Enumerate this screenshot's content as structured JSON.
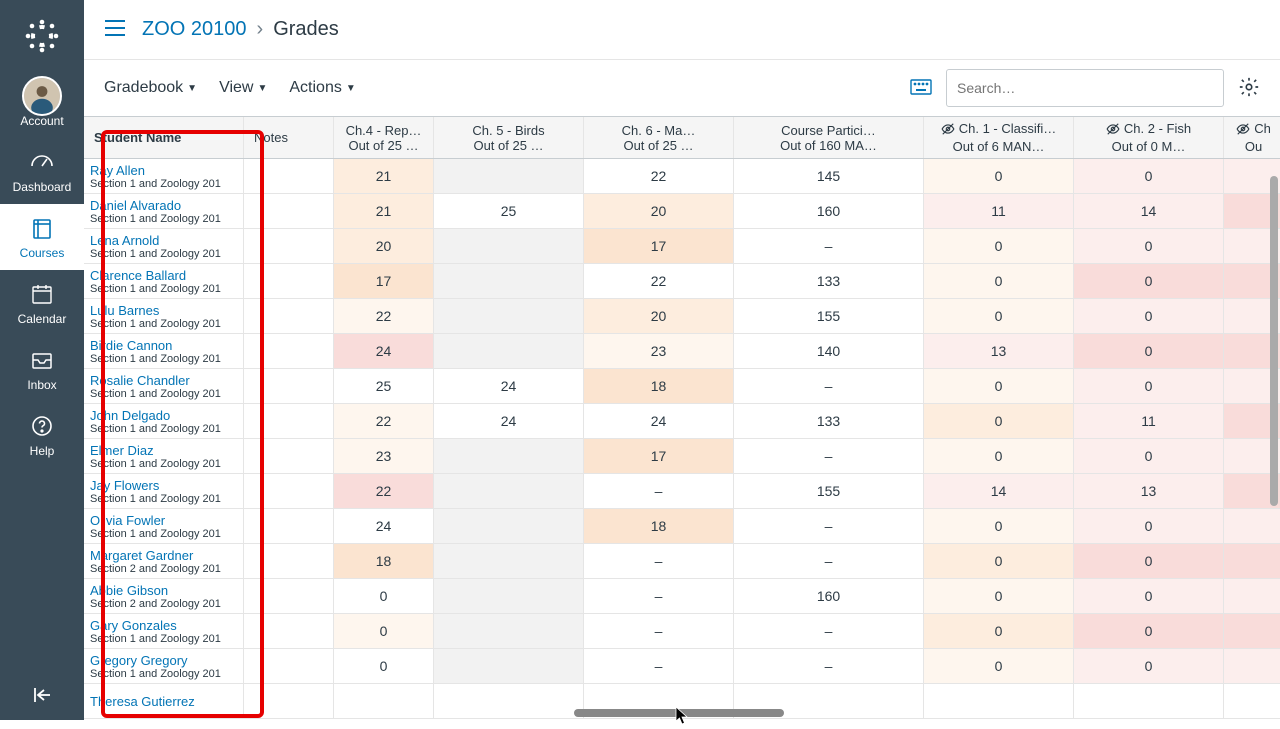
{
  "nav": {
    "account": "Account",
    "dashboard": "Dashboard",
    "courses": "Courses",
    "calendar": "Calendar",
    "inbox": "Inbox",
    "help": "Help"
  },
  "breadcrumb": {
    "course": "ZOO 20100",
    "page": "Grades"
  },
  "toolbar": {
    "gradebook": "Gradebook",
    "view": "View",
    "actions": "Actions",
    "search_placeholder": "Search…"
  },
  "columns": {
    "student": "Student Name",
    "notes": "Notes",
    "assignments": [
      {
        "title": "Ch.4 - Rep…",
        "sub": "Out of 25 …",
        "hidden": false
      },
      {
        "title": "Ch. 5 - Birds",
        "sub": "Out of 25 …",
        "hidden": false
      },
      {
        "title": "Ch. 6 - Ma…",
        "sub": "Out of 25 …",
        "hidden": false
      },
      {
        "title": "Course Partici…",
        "sub": "Out of 160 MA…",
        "hidden": false
      },
      {
        "title": "Ch. 1 - Classifi…",
        "sub": "Out of 6 MAN…",
        "hidden": true
      },
      {
        "title": "Ch. 2 - Fish",
        "sub": "Out of 0 M…",
        "hidden": true
      },
      {
        "title": "Ch",
        "sub": "Ou",
        "hidden": true
      }
    ]
  },
  "students": [
    {
      "name": "Ray Allen",
      "section": "Section 1 and Zoology 201",
      "cells": [
        "21",
        "",
        "22",
        "145",
        "0",
        "0",
        ""
      ]
    },
    {
      "name": "Daniel Alvarado",
      "section": "Section 1 and Zoology 201",
      "cells": [
        "21",
        "25",
        "20",
        "160",
        "11",
        "14",
        ""
      ]
    },
    {
      "name": "Lena Arnold",
      "section": "Section 1 and Zoology 201",
      "cells": [
        "20",
        "",
        "17",
        "–",
        "0",
        "0",
        ""
      ]
    },
    {
      "name": "Clarence Ballard",
      "section": "Section 1 and Zoology 201",
      "cells": [
        "17",
        "",
        "22",
        "133",
        "0",
        "0",
        ""
      ]
    },
    {
      "name": "Lulu Barnes",
      "section": "Section 1 and Zoology 201",
      "cells": [
        "22",
        "",
        "20",
        "155",
        "0",
        "0",
        ""
      ]
    },
    {
      "name": "Birdie Cannon",
      "section": "Section 1 and Zoology 201",
      "cells": [
        "24",
        "",
        "23",
        "140",
        "13",
        "0",
        ""
      ]
    },
    {
      "name": "Rosalie Chandler",
      "section": "Section 1 and Zoology 201",
      "cells": [
        "25",
        "24",
        "18",
        "–",
        "0",
        "0",
        ""
      ]
    },
    {
      "name": "John Delgado",
      "section": "Section 1 and Zoology 201",
      "cells": [
        "22",
        "24",
        "24",
        "133",
        "0",
        "11",
        ""
      ]
    },
    {
      "name": "Elmer Diaz",
      "section": "Section 1 and Zoology 201",
      "cells": [
        "23",
        "",
        "17",
        "–",
        "0",
        "0",
        ""
      ]
    },
    {
      "name": "Jay Flowers",
      "section": "Section 1 and Zoology 201",
      "cells": [
        "22",
        "",
        "–",
        "155",
        "14",
        "13",
        ""
      ]
    },
    {
      "name": "Olivia Fowler",
      "section": "Section 1 and Zoology 201",
      "cells": [
        "24",
        "",
        "18",
        "–",
        "0",
        "0",
        ""
      ]
    },
    {
      "name": "Margaret Gardner",
      "section": "Section 2 and Zoology 201",
      "cells": [
        "18",
        "",
        "–",
        "–",
        "0",
        "0",
        ""
      ]
    },
    {
      "name": "Abbie Gibson",
      "section": "Section 2 and Zoology 201",
      "cells": [
        "0",
        "",
        "–",
        "160",
        "0",
        "0",
        ""
      ]
    },
    {
      "name": "Gary Gonzales",
      "section": "Section 1 and Zoology 201",
      "cells": [
        "0",
        "",
        "–",
        "–",
        "0",
        "0",
        ""
      ]
    },
    {
      "name": "Gregory Gregory",
      "section": "Section 1 and Zoology 201",
      "cells": [
        "0",
        "",
        "–",
        "–",
        "0",
        "0",
        ""
      ]
    },
    {
      "name": "Theresa Gutierrez",
      "section": "",
      "cells": [
        "",
        "",
        "",
        "",
        "",
        "",
        ""
      ]
    }
  ],
  "shading": [
    [
      "w2",
      "1",
      "0",
      "0",
      "w1",
      "r1",
      "r1"
    ],
    [
      "w2",
      "0",
      "w2",
      "0",
      "r1",
      "r1",
      "r2"
    ],
    [
      "w2",
      "1",
      "w3",
      "0",
      "w1",
      "r1",
      "r1"
    ],
    [
      "w3",
      "1",
      "0",
      "0",
      "w1",
      "r2",
      "r2"
    ],
    [
      "w1",
      "1",
      "w2",
      "0",
      "w1",
      "r1",
      "r1"
    ],
    [
      "r2",
      "1",
      "w1",
      "0",
      "r1",
      "r2",
      "r2"
    ],
    [
      "0",
      "0",
      "w3",
      "0",
      "w1",
      "r1",
      "r1"
    ],
    [
      "w1",
      "0",
      "0",
      "0",
      "w2",
      "r1",
      "r2"
    ],
    [
      "w1",
      "1",
      "w3",
      "0",
      "w1",
      "r1",
      "r1"
    ],
    [
      "r2",
      "1",
      "0",
      "0",
      "r1",
      "r1",
      "r2"
    ],
    [
      "0",
      "1",
      "w3",
      "0",
      "w1",
      "r1",
      "r1"
    ],
    [
      "w3",
      "1",
      "0",
      "0",
      "w2",
      "r2",
      "r2"
    ],
    [
      "0",
      "1",
      "0",
      "0",
      "w1",
      "r1",
      "r1"
    ],
    [
      "w1",
      "1",
      "0",
      "0",
      "w2",
      "r2",
      "r2"
    ],
    [
      "0",
      "1",
      "0",
      "0",
      "w1",
      "r1",
      "r1"
    ],
    [
      "0",
      "0",
      "0",
      "0",
      "0",
      "0",
      "0"
    ]
  ],
  "chart_data": {
    "type": "table",
    "title": "ZOO 20100 Gradebook",
    "columns": [
      "Student Name",
      "Ch.4 - Rep (25)",
      "Ch.5 - Birds (25)",
      "Ch.6 - Ma (25)",
      "Course Participation (160)",
      "Ch.1 - Classifi (6)",
      "Ch.2 - Fish (0)"
    ],
    "rows": [
      [
        "Ray Allen",
        21,
        null,
        22,
        145,
        0,
        0
      ],
      [
        "Daniel Alvarado",
        21,
        25,
        20,
        160,
        11,
        14
      ],
      [
        "Lena Arnold",
        20,
        null,
        17,
        null,
        0,
        0
      ],
      [
        "Clarence Ballard",
        17,
        null,
        22,
        133,
        0,
        0
      ],
      [
        "Lulu Barnes",
        22,
        null,
        20,
        155,
        0,
        0
      ],
      [
        "Birdie Cannon",
        24,
        null,
        23,
        140,
        13,
        0
      ],
      [
        "Rosalie Chandler",
        25,
        24,
        18,
        null,
        0,
        0
      ],
      [
        "John Delgado",
        22,
        24,
        24,
        133,
        0,
        11
      ],
      [
        "Elmer Diaz",
        23,
        null,
        17,
        null,
        0,
        0
      ],
      [
        "Jay Flowers",
        22,
        null,
        null,
        155,
        14,
        13
      ],
      [
        "Olivia Fowler",
        24,
        null,
        18,
        null,
        0,
        0
      ],
      [
        "Margaret Gardner",
        18,
        null,
        null,
        null,
        0,
        0
      ],
      [
        "Abbie Gibson",
        0,
        null,
        null,
        160,
        0,
        0
      ],
      [
        "Gary Gonzales",
        0,
        null,
        null,
        null,
        0,
        0
      ],
      [
        "Gregory Gregory",
        0,
        null,
        null,
        null,
        0,
        0
      ]
    ]
  }
}
